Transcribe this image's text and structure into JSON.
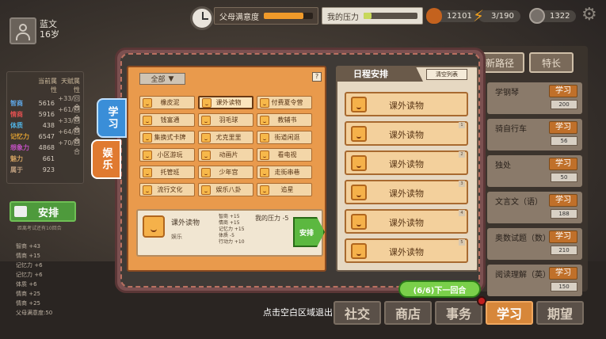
{
  "player": {
    "name": "蓝文",
    "age": "16岁"
  },
  "meters": {
    "parent_label": "父母满意度",
    "parent_value": 0.8,
    "stress_label": "我的压力",
    "stress_value": 0.15
  },
  "resources": {
    "coins": "12101",
    "energy": "3/190",
    "points": "1322"
  },
  "stats": {
    "headers": [
      "当前属性",
      "天赋属性"
    ],
    "rows": [
      {
        "name": "智商",
        "value": "5616",
        "talent": "+33/回合",
        "color": "#5fa8e8"
      },
      {
        "name": "情商",
        "value": "5916",
        "talent": "+61/回合",
        "color": "#e05050"
      },
      {
        "name": "体质",
        "value": "438",
        "talent": "+33/回合",
        "color": "#50b0e0"
      },
      {
        "name": "记忆力",
        "value": "6547",
        "talent": "+64/回合",
        "color": "#e0a030"
      },
      {
        "name": "想象力",
        "value": "4868",
        "talent": "+70/回合",
        "color": "#c050c0"
      },
      {
        "name": "魅力",
        "value": "661",
        "talent": "",
        "color": "#d0a060"
      },
      {
        "name": "属于",
        "value": "923",
        "talent": "",
        "color": "#c0a080"
      }
    ]
  },
  "arrange_button": "安排",
  "arrange_hint": "距离考试还有10回合",
  "bonus_lines": [
    "智商 +43",
    "情商 +15",
    "记忆力 +6",
    "记忆力 +6",
    "体质 +6",
    "情商 +25",
    "情商 +25",
    "父母满意度:50"
  ],
  "right_tabs": [
    "新路径",
    "特长"
  ],
  "skills": [
    {
      "name": "学钢琴",
      "button": "学习",
      "number": "200"
    },
    {
      "name": "骑自行车",
      "button": "学习",
      "number": "56"
    },
    {
      "name": "独处",
      "button": "学习",
      "number": "50"
    },
    {
      "name": "文言文（语）",
      "button": "学习",
      "number": "188"
    },
    {
      "name": "奥数试题（数）",
      "button": "学习",
      "number": "210"
    },
    {
      "name": "阅读理解（英）",
      "button": "学习",
      "number": "150"
    }
  ],
  "side_tabs": {
    "study": "学习",
    "fun": "娱乐"
  },
  "filter_label": "全部",
  "help_label": "?",
  "activities": [
    [
      "橡皮泥",
      "课外读物",
      "付费夏令营"
    ],
    [
      "钱富通",
      "羽毛球",
      "教辅书"
    ],
    [
      "集换式卡牌",
      "尤克里里",
      "街道闲逛"
    ],
    [
      "小区游玩",
      "动画片",
      "看电视"
    ],
    [
      "托管班",
      "少年宫",
      "走街串巷"
    ],
    [
      "流行文化",
      "娱乐八卦",
      "追星"
    ]
  ],
  "detail": {
    "name": "课外读物",
    "category": "娱乐",
    "effects": [
      "智商 +15",
      "情商 +15",
      "记忆力 +15",
      "体质 -5",
      "行动力 +10"
    ],
    "pressure": "我的压力 -5",
    "go_button": "安排"
  },
  "schedule": {
    "title": "日程安排",
    "clear_button": "清空列表",
    "slots": [
      "课外读物",
      "课外读物",
      "课外读物",
      "课外读物",
      "课外读物",
      "课外读物"
    ],
    "slot_numbers": [
      "",
      "1",
      "2",
      "3",
      "4",
      "5"
    ]
  },
  "next_button": "(6/6)下一回合",
  "exit_hint": "点击空白区域退出",
  "bottom_nav": [
    "社交",
    "商店",
    "事务",
    "学习",
    "期望"
  ]
}
